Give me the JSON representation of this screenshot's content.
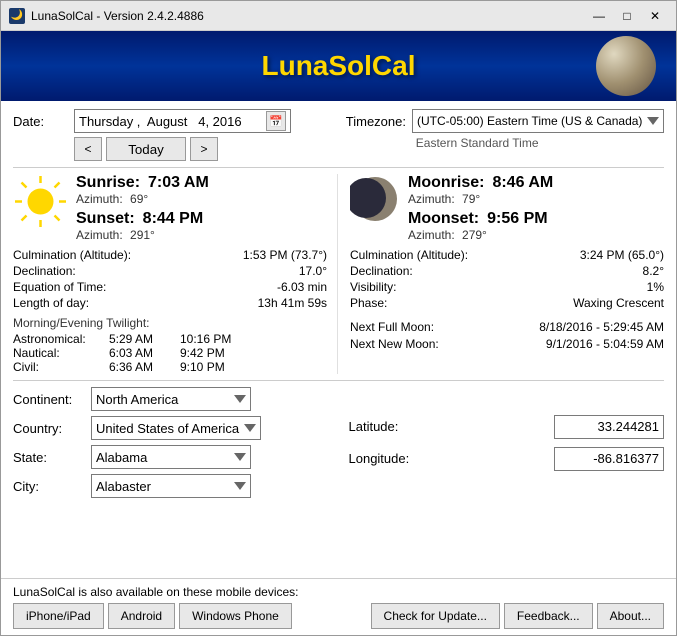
{
  "titlebar": {
    "title": "LunaSolCal - Version 2.4.2.4886",
    "icon": "🌙",
    "minimize": "—",
    "maximize": "□",
    "close": "✕"
  },
  "banner": {
    "title": "LunaSolCal"
  },
  "date": {
    "label": "Date:",
    "day": "Thursday",
    "month": "August",
    "day_num": "4",
    "year": "2016",
    "display": "Thursday ,  August   4, 2016",
    "prev_label": "<",
    "today_label": "Today",
    "next_label": ">"
  },
  "timezone": {
    "label": "Timezone:",
    "value": "(UTC-05:00) Eastern Time (US & Canada)",
    "sub": "Eastern Standard Time"
  },
  "sun": {
    "sunrise_label": "Sunrise:",
    "sunrise_time": "7:03 AM",
    "sunrise_az_label": "Azimuth:",
    "sunrise_az": "69°",
    "sunset_label": "Sunset:",
    "sunset_time": "8:44 PM",
    "sunset_az_label": "Azimuth:",
    "sunset_az": "291°"
  },
  "moon": {
    "moonrise_label": "Moonrise:",
    "moonrise_time": "8:46 AM",
    "moonrise_az_label": "Azimuth:",
    "moonrise_az": "79°",
    "moonset_label": "Moonset:",
    "moonset_time": "9:56 PM",
    "moonset_az_label": "Azimuth:",
    "moonset_az": "279°"
  },
  "sun_details": {
    "culmination_label": "Culmination (Altitude):",
    "culmination_val": "1:53 PM (73.7°)",
    "declination_label": "Declination:",
    "declination_val": "17.0°",
    "eq_time_label": "Equation of Time:",
    "eq_time_val": "-6.03 min",
    "day_length_label": "Length of day:",
    "day_length_val": "13h 41m 59s"
  },
  "moon_details": {
    "culmination_label": "Culmination (Altitude):",
    "culmination_val": "3:24 PM (65.0°)",
    "declination_label": "Declination:",
    "declination_val": "8.2°",
    "visibility_label": "Visibility:",
    "visibility_val": "1%",
    "phase_label": "Phase:",
    "phase_val": "Waxing Crescent"
  },
  "twilight": {
    "title": "Morning/Evening Twilight:",
    "astronomical_label": "Astronomical:",
    "astronomical_morning": "5:29 AM",
    "astronomical_evening": "10:16 PM",
    "nautical_label": "Nautical:",
    "nautical_morning": "6:03 AM",
    "nautical_evening": "9:42 PM",
    "civil_label": "Civil:",
    "civil_morning": "6:36 AM",
    "civil_evening": "9:10 PM"
  },
  "next_moons": {
    "full_moon_label": "Next Full Moon:",
    "full_moon_val": "8/18/2016 - 5:29:45 AM",
    "new_moon_label": "Next New Moon:",
    "new_moon_val": "9/1/2016 - 5:04:59 AM"
  },
  "location": {
    "continent_label": "Continent:",
    "continent_val": "North America",
    "country_label": "Country:",
    "country_val": "United States of America",
    "state_label": "State:",
    "state_val": "Alabama",
    "city_label": "City:",
    "city_val": "Alabaster",
    "latitude_label": "Latitude:",
    "latitude_val": "33.244281",
    "longitude_label": "Longitude:",
    "longitude_val": "-86.816377"
  },
  "footer": {
    "mobile_text": "LunaSolCal is also available on these mobile devices:",
    "iphone_btn": "iPhone/iPad",
    "android_btn": "Android",
    "windows_phone_btn": "Windows Phone",
    "check_update_btn": "Check for Update...",
    "feedback_btn": "Feedback...",
    "about_btn": "About..."
  }
}
